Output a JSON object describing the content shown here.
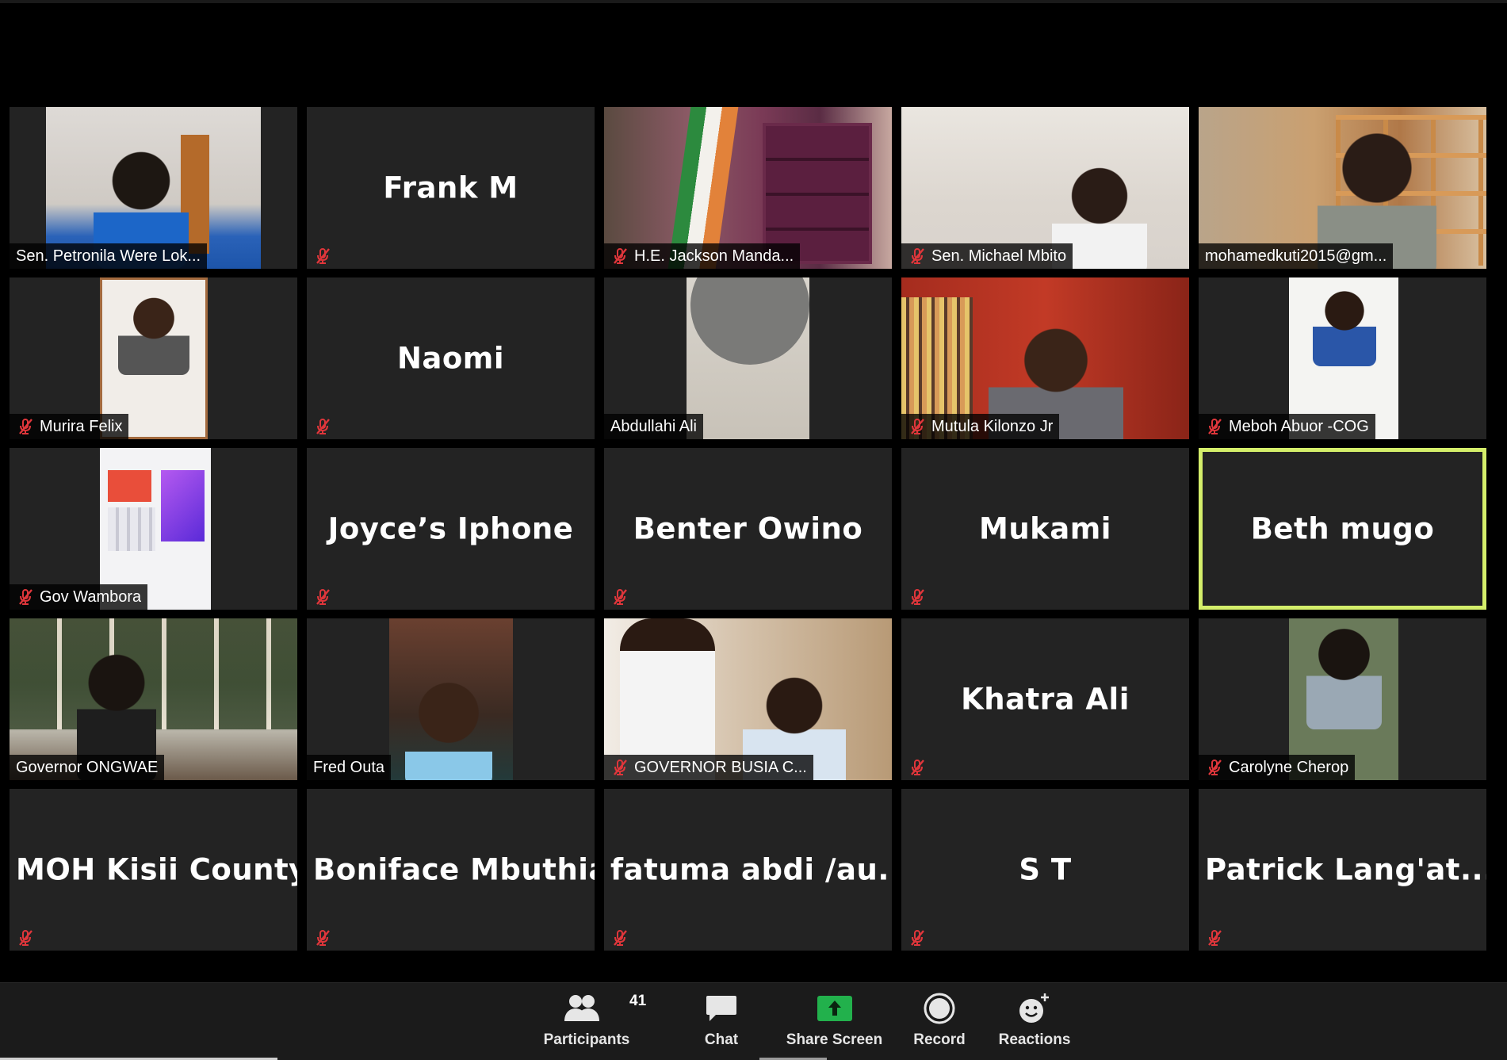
{
  "participants_grid": [
    {
      "name": "Sen. Petronila Were Lok...",
      "video": "petronila",
      "muted": false
    },
    {
      "name": "Frank M",
      "video": null,
      "muted": true
    },
    {
      "name": "H.E. Jackson Manda...",
      "video": "jackson",
      "muted": true
    },
    {
      "name": "Sen. Michael Mbito",
      "video": "mbito",
      "muted": true
    },
    {
      "name": "mohamedkuti2015@gm...",
      "video": "kuti",
      "muted": false
    },
    {
      "name": "Murira Felix",
      "video": "felix",
      "muted": true
    },
    {
      "name": "Naomi",
      "video": null,
      "muted": true
    },
    {
      "name": "Abdullahi Ali",
      "video": "abdullahi",
      "muted": false
    },
    {
      "name": "Mutula Kilonzo Jr",
      "video": "mutula",
      "muted": true
    },
    {
      "name": "Meboh Abuor -COG",
      "video": "meboh",
      "muted": true
    },
    {
      "name": "Gov Wambora",
      "video": "wambora",
      "muted": true
    },
    {
      "name": "Joyce’s Iphone",
      "video": null,
      "muted": true
    },
    {
      "name": "Benter Owino",
      "video": null,
      "muted": true
    },
    {
      "name": "Mukami",
      "video": null,
      "muted": true
    },
    {
      "name": "Beth mugo",
      "video": null,
      "muted": false,
      "active_speaker": true
    },
    {
      "name": "Governor ONGWAE",
      "video": "ongwae",
      "muted": false
    },
    {
      "name": "Fred Outa",
      "video": "outa",
      "muted": false
    },
    {
      "name": "GOVERNOR BUSIA C...",
      "video": "busia",
      "muted": true
    },
    {
      "name": "Khatra Ali",
      "video": null,
      "muted": true
    },
    {
      "name": "Carolyne Cherop",
      "video": "carolyne",
      "muted": true
    },
    {
      "name": "MOH Kisii County",
      "video": null,
      "muted": true
    },
    {
      "name": "Boniface Mbuthia",
      "video": null,
      "muted": true
    },
    {
      "name": "fatuma  abdi  /au...",
      "video": null,
      "muted": true
    },
    {
      "name": "S T",
      "video": null,
      "muted": true
    },
    {
      "name": "Patrick  Lang'at...",
      "video": null,
      "muted": true
    }
  ],
  "toolbar": {
    "participants_label": "Participants",
    "participants_count": "41",
    "chat_label": "Chat",
    "share_label": "Share Screen",
    "record_label": "Record",
    "reactions_label": "Reactions"
  },
  "colors": {
    "active_speaker_border": "#d4ee6a",
    "mute_icon": "#e0363b",
    "share_green": "#22b14c",
    "tile_bg": "#232323"
  }
}
